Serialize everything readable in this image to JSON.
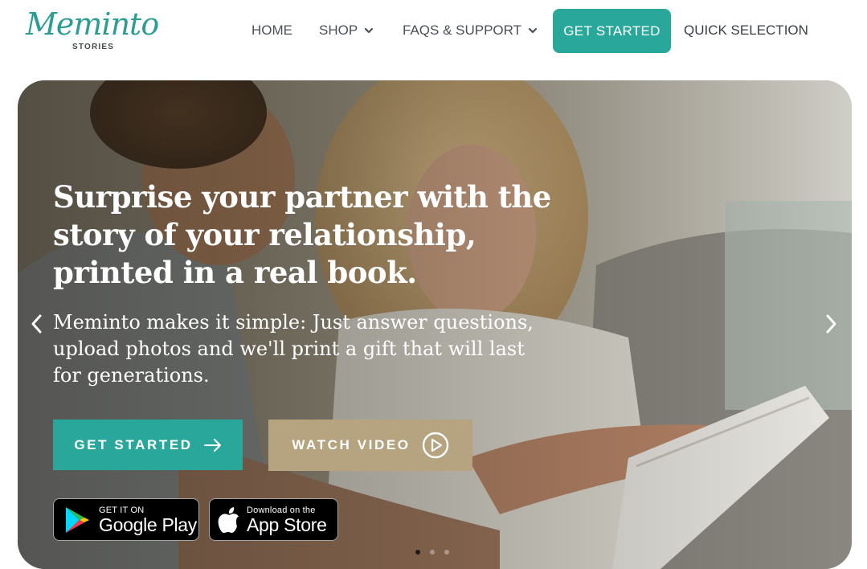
{
  "brand": {
    "logo_script": "Meminto",
    "logo_sub": "STORIES",
    "accent_color": "#2aa79b",
    "secondary_color": "#b5a47f"
  },
  "nav": {
    "home": "HOME",
    "shop": "SHOP",
    "faqs": "FAQS & SUPPORT",
    "get_started": "GET STARTED",
    "quick_selection": "QUICK SELECTION"
  },
  "hero": {
    "headline": "Surprise your partner with the story of your relationship, printed in a real book.",
    "subtext": "Meminto makes it simple: Just answer questions, upload photos and we'll print a gift that will last for generations.",
    "primary_button": "GET STARTED",
    "secondary_button": "WATCH VIDEO",
    "google_play_small": "GET IT ON",
    "google_play_big": "Google Play",
    "app_store_small": "Download on the",
    "app_store_big": "App Store",
    "slides_total": 3,
    "active_slide": 1
  },
  "icons": {
    "shop_chevron": "chevron-down-icon",
    "faqs_chevron": "chevron-down-icon",
    "start_arrow": "arrow-right-icon",
    "video_play": "play-circle-icon",
    "google_play": "google-play-icon",
    "apple": "apple-icon",
    "prev": "chevron-left-icon",
    "next": "chevron-right-icon"
  }
}
